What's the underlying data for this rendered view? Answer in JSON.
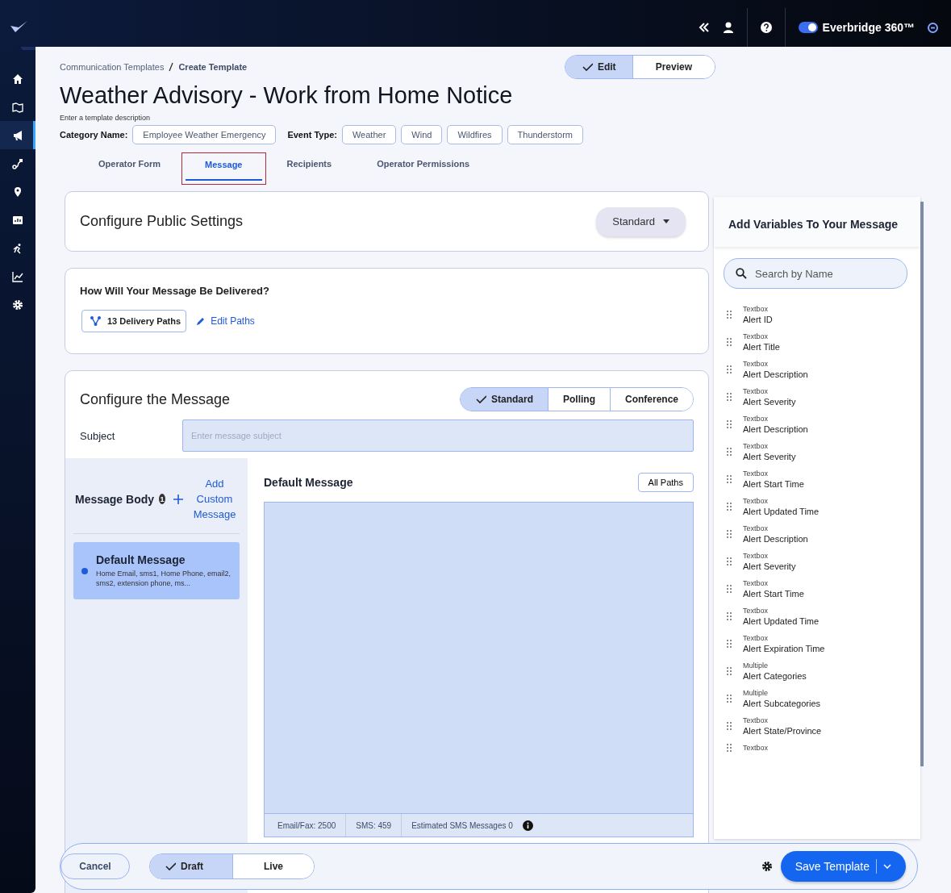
{
  "top_bar": {
    "product": "Everbridge 360™",
    "toggle_on": true
  },
  "sidebar": {
    "items": [
      {
        "selected": false
      },
      {
        "selected": false
      },
      {
        "selected": true
      },
      {
        "selected": false
      },
      {
        "selected": false
      },
      {
        "selected": false
      },
      {
        "selected": false
      },
      {
        "selected": false
      },
      {
        "selected": false
      }
    ]
  },
  "breadcrumb": [
    "Communication Templates",
    "Create Template"
  ],
  "mode_toggle": [
    {
      "label": "Edit",
      "selected": true
    },
    {
      "label": "Preview",
      "selected": false
    }
  ],
  "title": "Weather Advisory - Work from Home Notice",
  "description_placeholder": "Enter a template description",
  "category": {
    "label": "Category Name:",
    "value": "Employee Weather Emergency"
  },
  "event_type": {
    "label": "Event Type:",
    "values": [
      "Weather",
      "Wind",
      "Wildfires",
      "Thunderstorm"
    ]
  },
  "tabs": [
    {
      "label": "Operator Form",
      "selected": false
    },
    {
      "label": "Message",
      "selected": true
    },
    {
      "label": "Recipients",
      "selected": false
    },
    {
      "label": "Operator Permissions",
      "selected": false
    }
  ],
  "public_settings": {
    "title": "Configure Public Settings",
    "dropdown": "Standard"
  },
  "delivery": {
    "title": "How Will Your Message Be Delivered?",
    "paths_button": "13 Delivery Paths",
    "edit_link": "Edit Paths"
  },
  "configure": {
    "title": "Configure the Message",
    "types": [
      {
        "label": "Standard",
        "selected": true
      },
      {
        "label": "Polling",
        "selected": false
      },
      {
        "label": "Conference",
        "selected": false
      }
    ],
    "subject_label": "Subject",
    "subject_placeholder": "Enter message subject",
    "body_title": "Message Body",
    "body_badge": "1",
    "add_custom": "Add Custom Message",
    "messages": [
      {
        "title": "Default Message",
        "paths": "Home Email, sms1, Home Phone, email2, sms2, extension phone, ms...",
        "selected": true
      }
    ],
    "editor_title": "Default Message",
    "all_paths": "All Paths",
    "counts": [
      "Email/Fax: 2500",
      "SMS: 459",
      "Estimated SMS Messages 0"
    ]
  },
  "variables": {
    "title": "Add Variables To Your Message",
    "search_placeholder": "Search by Name",
    "items": [
      {
        "type": "Textbox",
        "name": "Alert ID"
      },
      {
        "type": "Textbox",
        "name": "Alert Title"
      },
      {
        "type": "Textbox",
        "name": "Alert Description"
      },
      {
        "type": "Textbox",
        "name": "Alert Severity"
      },
      {
        "type": "Textbox",
        "name": "Alert Description"
      },
      {
        "type": "Textbox",
        "name": "Alert Severity"
      },
      {
        "type": "Textbox",
        "name": "Alert Start Time"
      },
      {
        "type": "Textbox",
        "name": "Alert Updated Time"
      },
      {
        "type": "Textbox",
        "name": "Alert Description"
      },
      {
        "type": "Textbox",
        "name": "Alert Severity"
      },
      {
        "type": "Textbox",
        "name": "Alert Start Time"
      },
      {
        "type": "Textbox",
        "name": "Alert Updated Time"
      },
      {
        "type": "Textbox",
        "name": "Alert Expiration Time"
      },
      {
        "type": "Multiple",
        "name": "Alert Categories"
      },
      {
        "type": "Multiple",
        "name": "Alert Subcategories"
      },
      {
        "type": "Textbox",
        "name": "Alert State/Province"
      },
      {
        "type": "Textbox"
      }
    ]
  },
  "footer": {
    "cancel": "Cancel",
    "states": [
      {
        "label": "Draft",
        "selected": true
      },
      {
        "label": "Live",
        "selected": false
      }
    ],
    "save": "Save Template"
  }
}
